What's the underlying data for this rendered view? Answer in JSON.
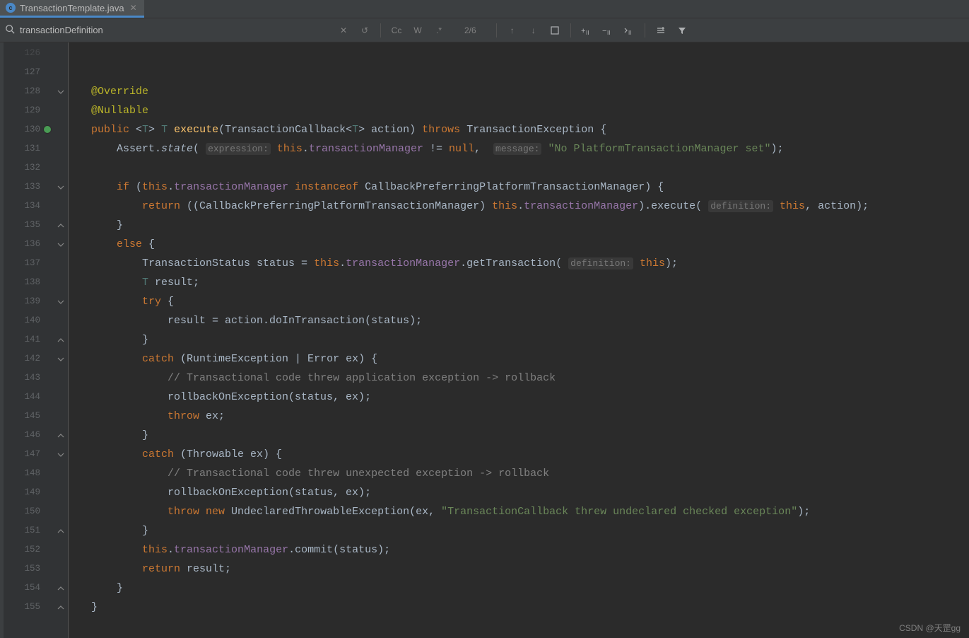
{
  "tab": {
    "filename": "TransactionTemplate.java",
    "icon_letter": "c"
  },
  "findbar": {
    "query": "transactionDefinition",
    "count": "2/6",
    "cc": "Cc",
    "w": "W",
    "regex": ".*"
  },
  "gutter_start": 126,
  "lines": [
    {
      "n": 126,
      "faded": true,
      "html": ""
    },
    {
      "n": 127,
      "html": ""
    },
    {
      "n": 128,
      "fold": "down",
      "html": "<span class='ann'>@Override</span>"
    },
    {
      "n": 129,
      "html": "<span class='ann'>@Nullable</span>"
    },
    {
      "n": 130,
      "marker": true,
      "arrow": true,
      "html": "<span class='kw'>public</span> &lt;<span class='generic'>T</span>&gt; <span class='generic'>T</span> <span class='mtd'>execute</span>(TransactionCallback&lt;<span class='generic'>T</span>&gt; action) <span class='kw'>throws</span> TransactionException {"
    },
    {
      "n": 131,
      "html": "    Assert.<span class='italic'>state</span>( <span class='hint'>expression:</span> <span class='kw'>this</span>.<span class='fld'>transactionManager</span> != <span class='kw'>null</span>,  <span class='hint'>message:</span> <span class='str'>\"No PlatformTransactionManager set\"</span>);"
    },
    {
      "n": 132,
      "html": ""
    },
    {
      "n": 133,
      "fold": "down",
      "html": "    <span class='kw'>if</span> (<span class='kw'>this</span>.<span class='fld'>transactionManager</span> <span class='kw'>instanceof</span> CallbackPreferringPlatformTransactionManager) {"
    },
    {
      "n": 134,
      "html": "        <span class='kw'>return</span> ((CallbackPreferringPlatformTransactionManager) <span class='kw'>this</span>.<span class='fld'>transactionManager</span>).execute( <span class='hint'>definition:</span> <span class='kw'>this</span>, action);"
    },
    {
      "n": 135,
      "fold": "up",
      "html": "    }"
    },
    {
      "n": 136,
      "fold": "down",
      "html": "    <span class='kw'>else</span> {"
    },
    {
      "n": 137,
      "html": "        TransactionStatus status = <span class='kw'>this</span>.<span class='fld'>transactionManager</span>.getTransaction( <span class='hint'>definition:</span> <span class='kw'>this</span>);"
    },
    {
      "n": 138,
      "html": "        <span class='generic'>T</span> result;"
    },
    {
      "n": 139,
      "fold": "down",
      "html": "        <span class='kw'>try</span> {"
    },
    {
      "n": 140,
      "html": "            result = action.doInTransaction(status);"
    },
    {
      "n": 141,
      "fold": "up",
      "html": "        }"
    },
    {
      "n": 142,
      "fold": "down",
      "html": "        <span class='kw'>catch</span> (RuntimeException | Error ex) {"
    },
    {
      "n": 143,
      "html": "            <span class='cmt'>// Transactional code threw application exception -&gt; rollback</span>"
    },
    {
      "n": 144,
      "html": "            rollbackOnException(status, ex);"
    },
    {
      "n": 145,
      "html": "            <span class='kw'>throw</span> ex;"
    },
    {
      "n": 146,
      "fold": "up",
      "html": "        }"
    },
    {
      "n": 147,
      "fold": "down",
      "html": "        <span class='kw'>catch</span> (Throwable ex) {"
    },
    {
      "n": 148,
      "html": "            <span class='cmt'>// Transactional code threw unexpected exception -&gt; rollback</span>"
    },
    {
      "n": 149,
      "html": "            rollbackOnException(status, ex);"
    },
    {
      "n": 150,
      "html": "            <span class='kw'>throw new</span> UndeclaredThrowableException(ex, <span class='str'>\"TransactionCallback threw undeclared checked exception\"</span>);"
    },
    {
      "n": 151,
      "fold": "up",
      "html": "        }"
    },
    {
      "n": 152,
      "html": "        <span class='kw'>this</span>.<span class='fld'>transactionManager</span>.commit(status);"
    },
    {
      "n": 153,
      "html": "        <span class='kw'>return</span> result;"
    },
    {
      "n": 154,
      "fold": "up",
      "html": "    }"
    },
    {
      "n": 155,
      "fold": "up",
      "html": "}"
    }
  ],
  "watermark": "CSDN @天罡gg"
}
